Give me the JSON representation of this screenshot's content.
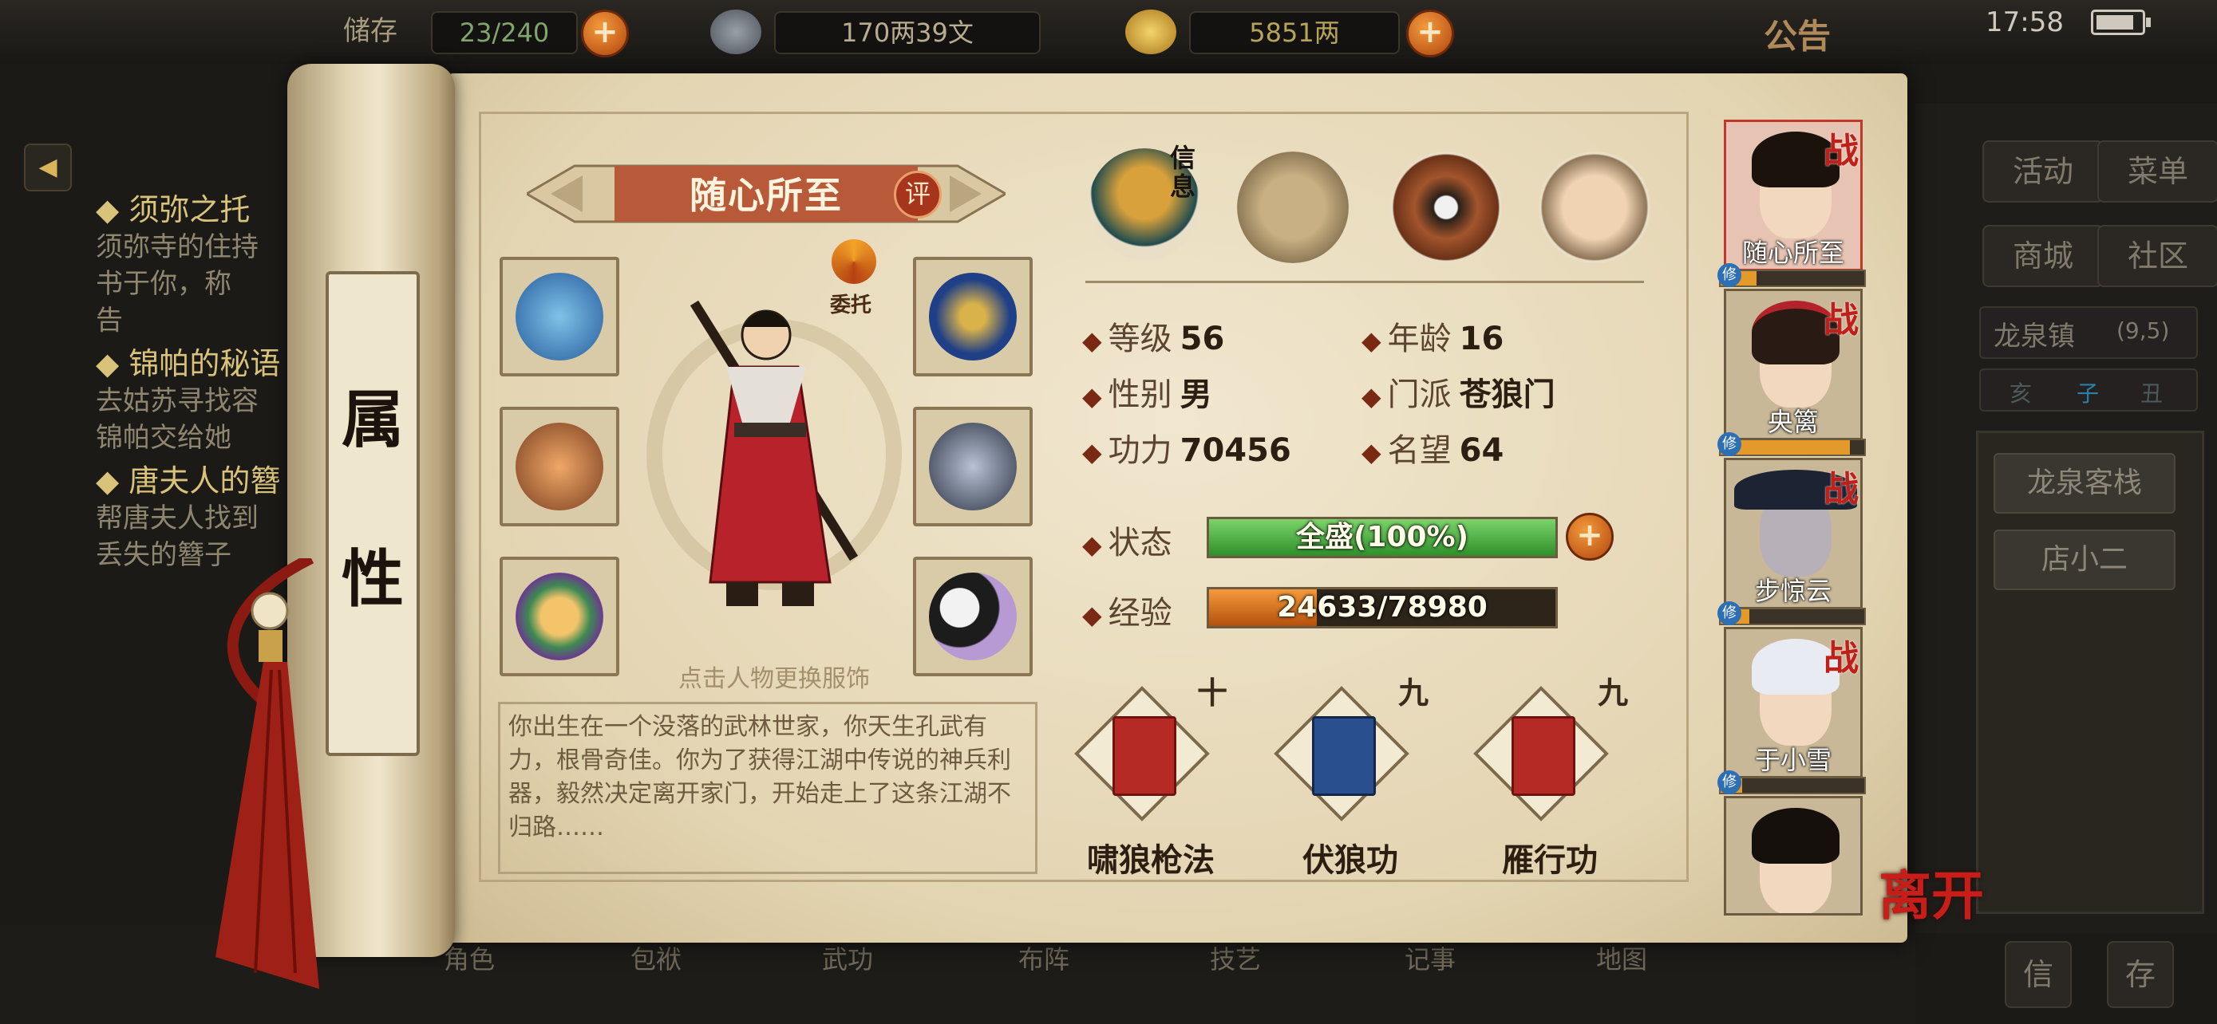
{
  "topbar": {
    "backpack_label": "储存",
    "backpack_count": "23/240",
    "silver": "170两39文",
    "gold": "5851两",
    "notice": "公告",
    "time": "17:58"
  },
  "quests": [
    {
      "title": "须弥之托",
      "desc": [
        "须弥寺的住持",
        "书于你，称",
        "告"
      ]
    },
    {
      "title": "锦帕的秘语",
      "desc": [
        "去姑苏寻找容",
        "锦帕交给她"
      ]
    },
    {
      "title": "唐夫人的簪",
      "desc": [
        "帮唐夫人找到",
        "丢失的簪子"
      ]
    }
  ],
  "right_menu": {
    "activity": "活动",
    "menu": "菜单",
    "shop": "商城",
    "community": "社区",
    "location": "龙泉镇",
    "coords": "(9,5)",
    "time_row": [
      "亥",
      "子",
      "丑"
    ],
    "places": [
      "龙泉客栈",
      "店小二"
    ],
    "bottom_buttons": [
      "信",
      "存"
    ]
  },
  "scroll": {
    "tab_label": [
      "属",
      "性"
    ]
  },
  "character": {
    "name": "随心所至",
    "rate_label": "评",
    "entrust_label": "委托",
    "hint": "点击人物更换服饰",
    "description": "你出生在一个没落的武林世家，你天生孔武有力，根骨奇佳。你为了获得江湖中传说的神兵利器，毅然决定离开家门，开始走上了这条江湖不归路……"
  },
  "top_icons": {
    "info_label": "信息"
  },
  "stats": {
    "level_label": "等级",
    "level": "56",
    "age_label": "年龄",
    "age": "16",
    "gender_label": "性别",
    "gender": "男",
    "sect_label": "门派",
    "sect": "苍狼门",
    "power_label": "功力",
    "power": "70456",
    "fame_label": "名望",
    "fame": "64",
    "status_label": "状态",
    "status": "全盛(100%)",
    "status_fill": 1.0,
    "exp_label": "经验",
    "exp": "24633/78980",
    "exp_fill": 0.312
  },
  "skills": [
    {
      "name": "啸狼枪法",
      "level": "十"
    },
    {
      "name": "伏狼功",
      "level": "九"
    },
    {
      "name": "雁行功",
      "level": "九"
    }
  ],
  "party": [
    {
      "name": "随心所至",
      "battle": "战",
      "xiu_fill": 0.25
    },
    {
      "name": "央篱",
      "battle": "战",
      "xiu_fill": 0.9
    },
    {
      "name": "步惊云",
      "battle": "战",
      "xiu_fill": 0.2
    },
    {
      "name": "于小雪",
      "battle": "战",
      "xiu_fill": 0.15
    },
    {
      "name": "",
      "battle": "",
      "xiu_fill": 0
    }
  ],
  "xiu_label": "修",
  "bottom_nav": [
    "角色",
    "包袱",
    "武功",
    "布阵",
    "技艺",
    "记事",
    "地图"
  ],
  "leave_label": "离开",
  "colors": {
    "status_green": "#3fae3a",
    "exp_orange": "#e0761d",
    "battle_red": "#c0201a"
  }
}
